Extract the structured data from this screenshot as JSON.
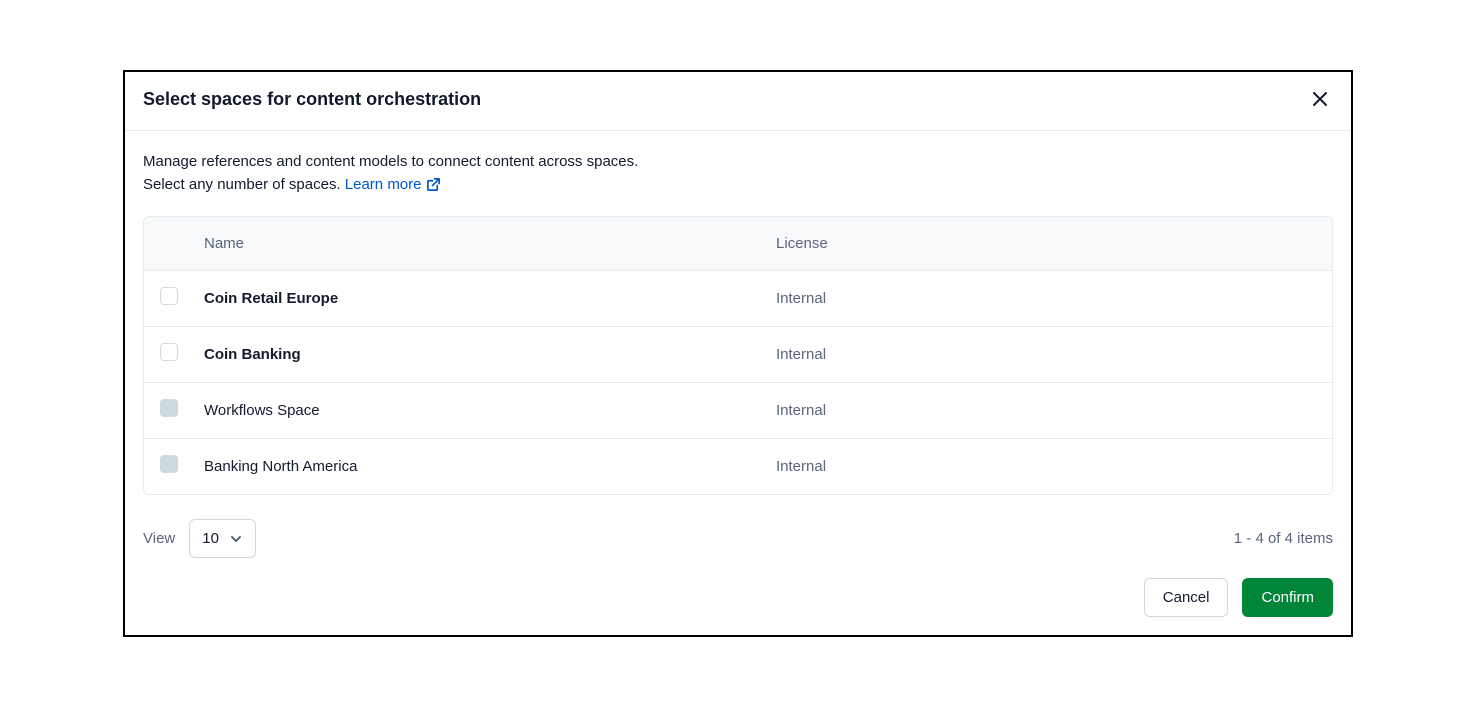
{
  "modal": {
    "title": "Select spaces for content orchestration",
    "description_line1": "Manage references and content models to connect content across spaces.",
    "description_line2_prefix": "Select any number of spaces. ",
    "learn_more_label": "Learn more"
  },
  "table": {
    "headers": {
      "name": "Name",
      "license": "License"
    },
    "rows": [
      {
        "name": "Coin Retail Europe",
        "license": "Internal",
        "bold": true,
        "disabled": false
      },
      {
        "name": "Coin Banking",
        "license": "Internal",
        "bold": true,
        "disabled": false
      },
      {
        "name": "Workflows Space",
        "license": "Internal",
        "bold": false,
        "disabled": true
      },
      {
        "name": "Banking North America",
        "license": "Internal",
        "bold": false,
        "disabled": true
      }
    ]
  },
  "footer": {
    "view_label": "View",
    "view_value": "10",
    "pagination": "1 - 4 of 4 items"
  },
  "actions": {
    "cancel": "Cancel",
    "confirm": "Confirm"
  }
}
